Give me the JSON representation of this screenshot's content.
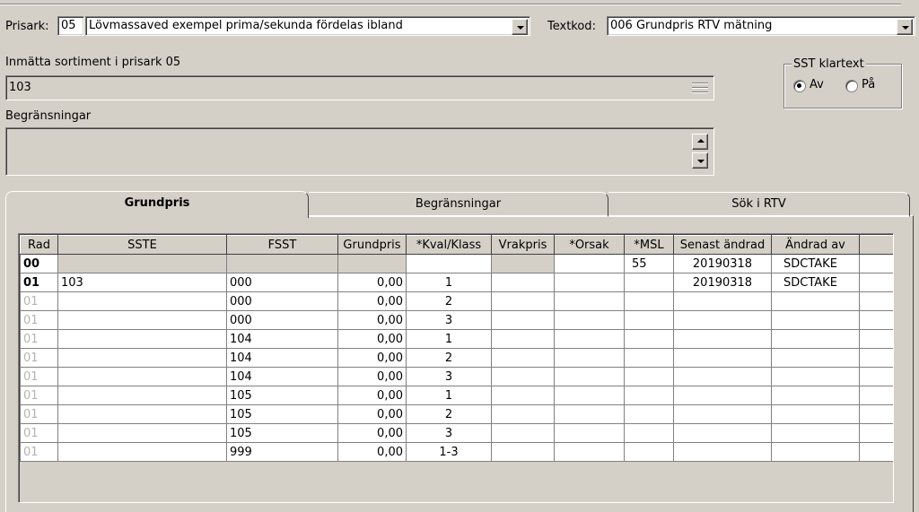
{
  "prisark": {
    "label": "Prisark:",
    "code": "05",
    "value": "Lövmassaved exempel prima/sekunda fördelas ibland"
  },
  "textkod": {
    "label": "Textkod:",
    "value": "006 Grundpris RTV mätning"
  },
  "sortiment": {
    "label": "Inmätta sortiment i prisark 05",
    "value": "103"
  },
  "begransningar_field": {
    "label": "Begränsningar",
    "value": ""
  },
  "sst_klartext": {
    "title": "SST klartext",
    "options": [
      "Av",
      "På"
    ],
    "selected": "Av"
  },
  "tabs": [
    {
      "label": "Grundpris",
      "active": true
    },
    {
      "label": "Begränsningar",
      "active": false
    },
    {
      "label": "Sök i RTV",
      "active": false
    }
  ],
  "grid": {
    "headers": [
      "Rad",
      "SSTE",
      "FSST",
      "Grundpris",
      "*Kval/Klass",
      "Vrakpris",
      "*Orsak",
      "*MSL",
      "Senast ändrad",
      "Ändrad av",
      ""
    ],
    "rows": [
      {
        "rad": "00",
        "sste": "",
        "fsst": "",
        "grundpris": "",
        "kval": "",
        "vrakpris": "",
        "orsak": "",
        "msl": "55",
        "senast": "20190318",
        "andrad": "SDCTAKE"
      },
      {
        "rad": "01",
        "sste": "103",
        "fsst": "000",
        "grundpris": "0,00",
        "kval": "1",
        "vrakpris": "",
        "orsak": "",
        "msl": "",
        "senast": "20190318",
        "andrad": "SDCTAKE"
      },
      {
        "rad": "01",
        "sste": "",
        "fsst": "000",
        "grundpris": "0,00",
        "kval": "2",
        "vrakpris": "",
        "orsak": "",
        "msl": "",
        "senast": "",
        "andrad": ""
      },
      {
        "rad": "01",
        "sste": "",
        "fsst": "000",
        "grundpris": "0,00",
        "kval": "3",
        "vrakpris": "",
        "orsak": "",
        "msl": "",
        "senast": "",
        "andrad": ""
      },
      {
        "rad": "01",
        "sste": "",
        "fsst": "104",
        "grundpris": "0,00",
        "kval": "1",
        "vrakpris": "",
        "orsak": "",
        "msl": "",
        "senast": "",
        "andrad": ""
      },
      {
        "rad": "01",
        "sste": "",
        "fsst": "104",
        "grundpris": "0,00",
        "kval": "2",
        "vrakpris": "",
        "orsak": "",
        "msl": "",
        "senast": "",
        "andrad": ""
      },
      {
        "rad": "01",
        "sste": "",
        "fsst": "104",
        "grundpris": "0,00",
        "kval": "3",
        "vrakpris": "",
        "orsak": "",
        "msl": "",
        "senast": "",
        "andrad": ""
      },
      {
        "rad": "01",
        "sste": "",
        "fsst": "105",
        "grundpris": "0,00",
        "kval": "1",
        "vrakpris": "",
        "orsak": "",
        "msl": "",
        "senast": "",
        "andrad": ""
      },
      {
        "rad": "01",
        "sste": "",
        "fsst": "105",
        "grundpris": "0,00",
        "kval": "2",
        "vrakpris": "",
        "orsak": "",
        "msl": "",
        "senast": "",
        "andrad": ""
      },
      {
        "rad": "01",
        "sste": "",
        "fsst": "105",
        "grundpris": "0,00",
        "kval": "3",
        "vrakpris": "",
        "orsak": "",
        "msl": "",
        "senast": "",
        "andrad": ""
      },
      {
        "rad": "01",
        "sste": "",
        "fsst": "999",
        "grundpris": "0,00",
        "kval": "1-3",
        "vrakpris": "",
        "orsak": "",
        "msl": "",
        "senast": "",
        "andrad": ""
      }
    ]
  }
}
